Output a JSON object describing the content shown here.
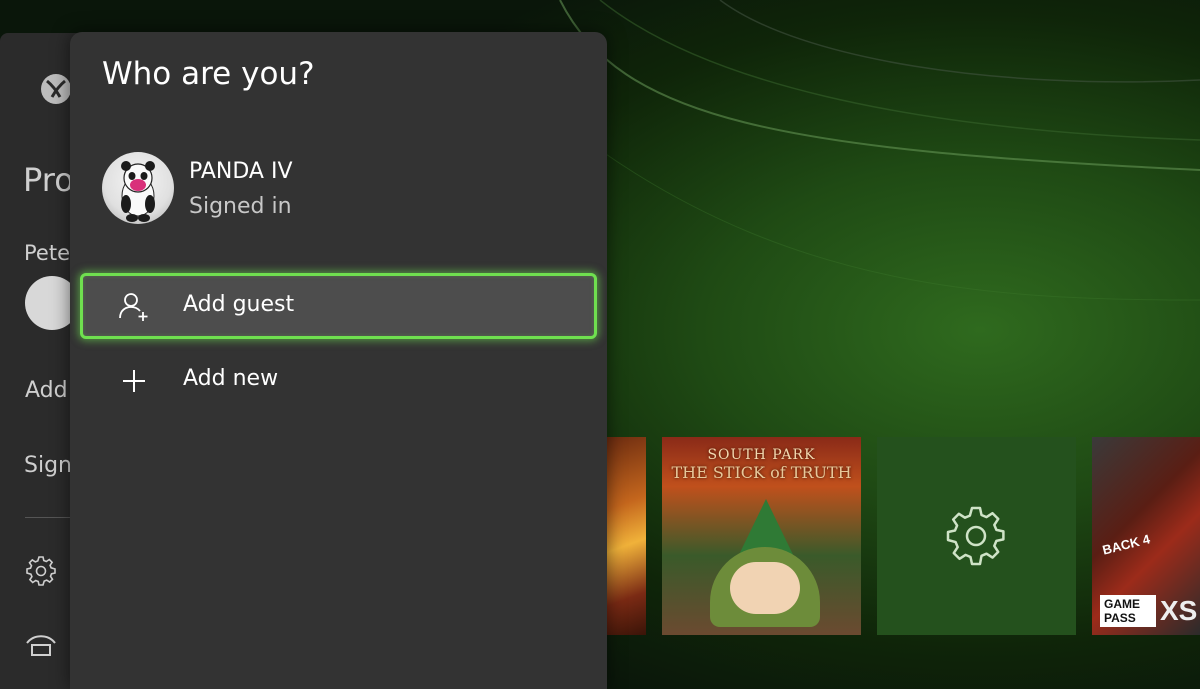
{
  "dialog": {
    "title": "Who are you?",
    "profile": {
      "name": "PANDA IV",
      "status": "Signed in",
      "avatar_icon": "panda-avatar"
    },
    "items": [
      {
        "label": "Add guest",
        "icon": "add-person-icon",
        "selected": true
      },
      {
        "label": "Add new",
        "icon": "plus-icon",
        "selected": false
      }
    ]
  },
  "underlying_panel": {
    "title_partial": "Pro",
    "name_partial": "Pete",
    "add_partial": "Add",
    "sign_partial": "Sign",
    "icons": [
      "xbox-logo-icon",
      "gear-icon",
      "power-icon"
    ]
  },
  "tiles": [
    {
      "name": "partial-game-tile"
    },
    {
      "name": "south-park-tile",
      "title": "SOUTH PARK",
      "subtitle": "THE STICK of TRUTH"
    },
    {
      "name": "settings-tile",
      "icon": "gear-icon"
    },
    {
      "name": "back-4-blood-tile",
      "title": "BACK 4",
      "badge": "GAME PASS",
      "badge_suffix": "XS"
    }
  ],
  "colors": {
    "accent_green": "#6fe04f",
    "dialog_bg": "#333333",
    "selected_bg": "#4d4d4d",
    "settings_tile": "#24511d"
  }
}
